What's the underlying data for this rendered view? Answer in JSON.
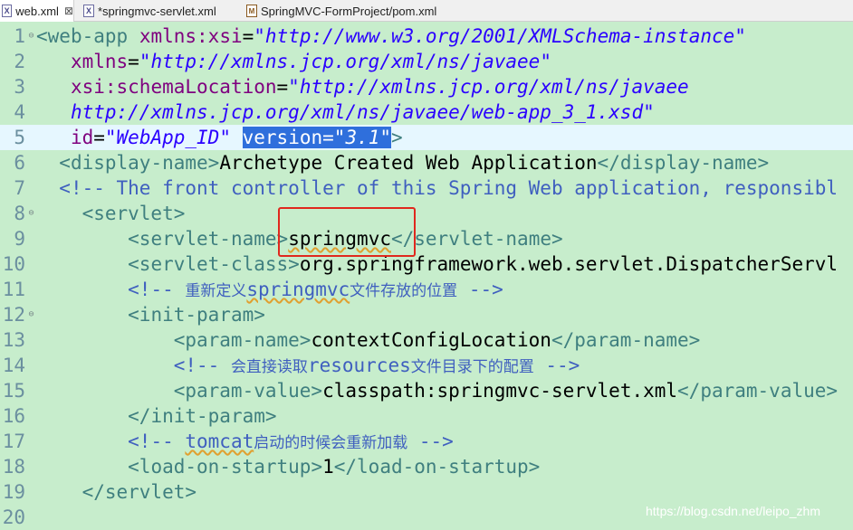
{
  "tabs": [
    {
      "label": "web.xml",
      "close": "⊠"
    },
    {
      "label": "*springmvc-servlet.xml"
    },
    {
      "label": "SpringMVC-FormProject/pom.xml"
    }
  ],
  "editor": {
    "line_numbers": [
      "1",
      "2",
      "3",
      "4",
      "5",
      "6",
      "7",
      "8",
      "9",
      "10",
      "11",
      "12",
      "13",
      "14",
      "15",
      "16",
      "17",
      "18",
      "19",
      "20"
    ],
    "lines": {
      "l1": {
        "open": "<",
        "tag": "web-app",
        "attr": "xmlns:xsi",
        "eq": "=",
        "val": "\"http://www.w3.org/2001/XMLSchema-instance\""
      },
      "l2": {
        "attr": "xmlns",
        "eq": "=",
        "val": "\"http://xmlns.jcp.org/xml/ns/javaee\""
      },
      "l3": {
        "attr": "xsi:schemaLocation",
        "eq": "=",
        "val": "\"http://xmlns.jcp.org/xml/ns/javaee"
      },
      "l4": {
        "val": "http://xmlns.jcp.org/xml/ns/javaee/web-app_3_1.xsd\""
      },
      "l5": {
        "attr1": "id",
        "eq": "=",
        "val1": "\"WebApp_ID\"",
        "attr2": "version",
        "val2": "\"3.1\"",
        "close": ">"
      },
      "l6": {
        "open": "<display-name>",
        "text": "Archetype Created Web Application",
        "close": "</display-name>"
      },
      "l7": {
        "comment": "<!-- The front controller of this Spring Web application, responsibl"
      },
      "l8": {
        "tag": "<servlet>"
      },
      "l9": {
        "open": "<servlet-name",
        "gt": ">",
        "text": "springmvc",
        "close": "</servlet-name>"
      },
      "l10": {
        "open": "<servlet-class>",
        "text": "org.springframework.web.servlet.DispatcherServl"
      },
      "l11": {
        "c_open": "<!-- ",
        "cj1": "重新定义",
        "cw": "springmvc",
        "cj2": "文件存放的位置",
        "c_close": " -->"
      },
      "l12": {
        "tag": "<init-param>"
      },
      "l13": {
        "open": "<param-name>",
        "text": "contextConfigLocation",
        "close": "</param-name>"
      },
      "l14": {
        "c_open": "<!-- ",
        "cj1": "会直接读取",
        "cw": "resources",
        "cj2": "文件目录下的配置",
        "c_close": " -->"
      },
      "l15": {
        "open": "<param-value>",
        "text": "classpath:springmvc-servlet.xml",
        "close": "</param-value>"
      },
      "l16": {
        "tag": "</init-param>"
      },
      "l17": {
        "c_open": "<!-- ",
        "cw": "tomcat",
        "cj2": "启动的时候会重新加载",
        "c_close": " -->"
      },
      "l18": {
        "open": "<load-on-startup>",
        "text": "1",
        "close": "</load-on-startup>"
      },
      "l19": {
        "tag": "</servlet>"
      }
    }
  },
  "watermark": "https://blog.csdn.net/leipo_zhm",
  "colors": {
    "background": "#c7edcc",
    "tag": "#3f7f7f",
    "attr": "#7f007f",
    "value": "#2a00ff",
    "comment": "#3f5fbf",
    "highlight_box": "#e0281e",
    "selection": "#2f6fdc"
  }
}
